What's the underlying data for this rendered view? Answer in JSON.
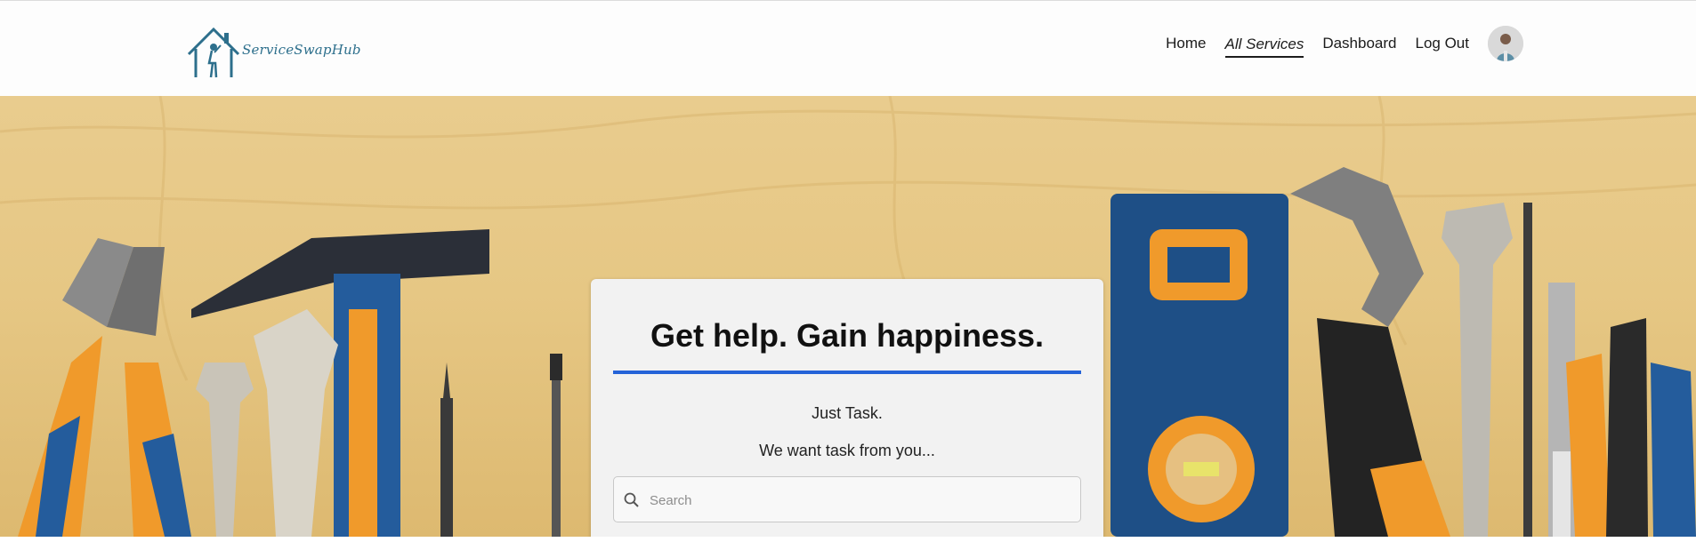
{
  "brand": {
    "name": "ServiceSwapHub"
  },
  "nav": {
    "items": [
      {
        "label": "Home",
        "active": false
      },
      {
        "label": "All Services",
        "active": true
      },
      {
        "label": "Dashboard",
        "active": false
      },
      {
        "label": "Log Out",
        "active": false
      }
    ]
  },
  "hero": {
    "headline": "Get help. Gain happiness.",
    "line1": "Just Task.",
    "line2": "We want task from you...",
    "search": {
      "placeholder": "Search",
      "value": ""
    }
  },
  "colors": {
    "accent": "#2563d8",
    "brand": "#2d6f8c"
  }
}
